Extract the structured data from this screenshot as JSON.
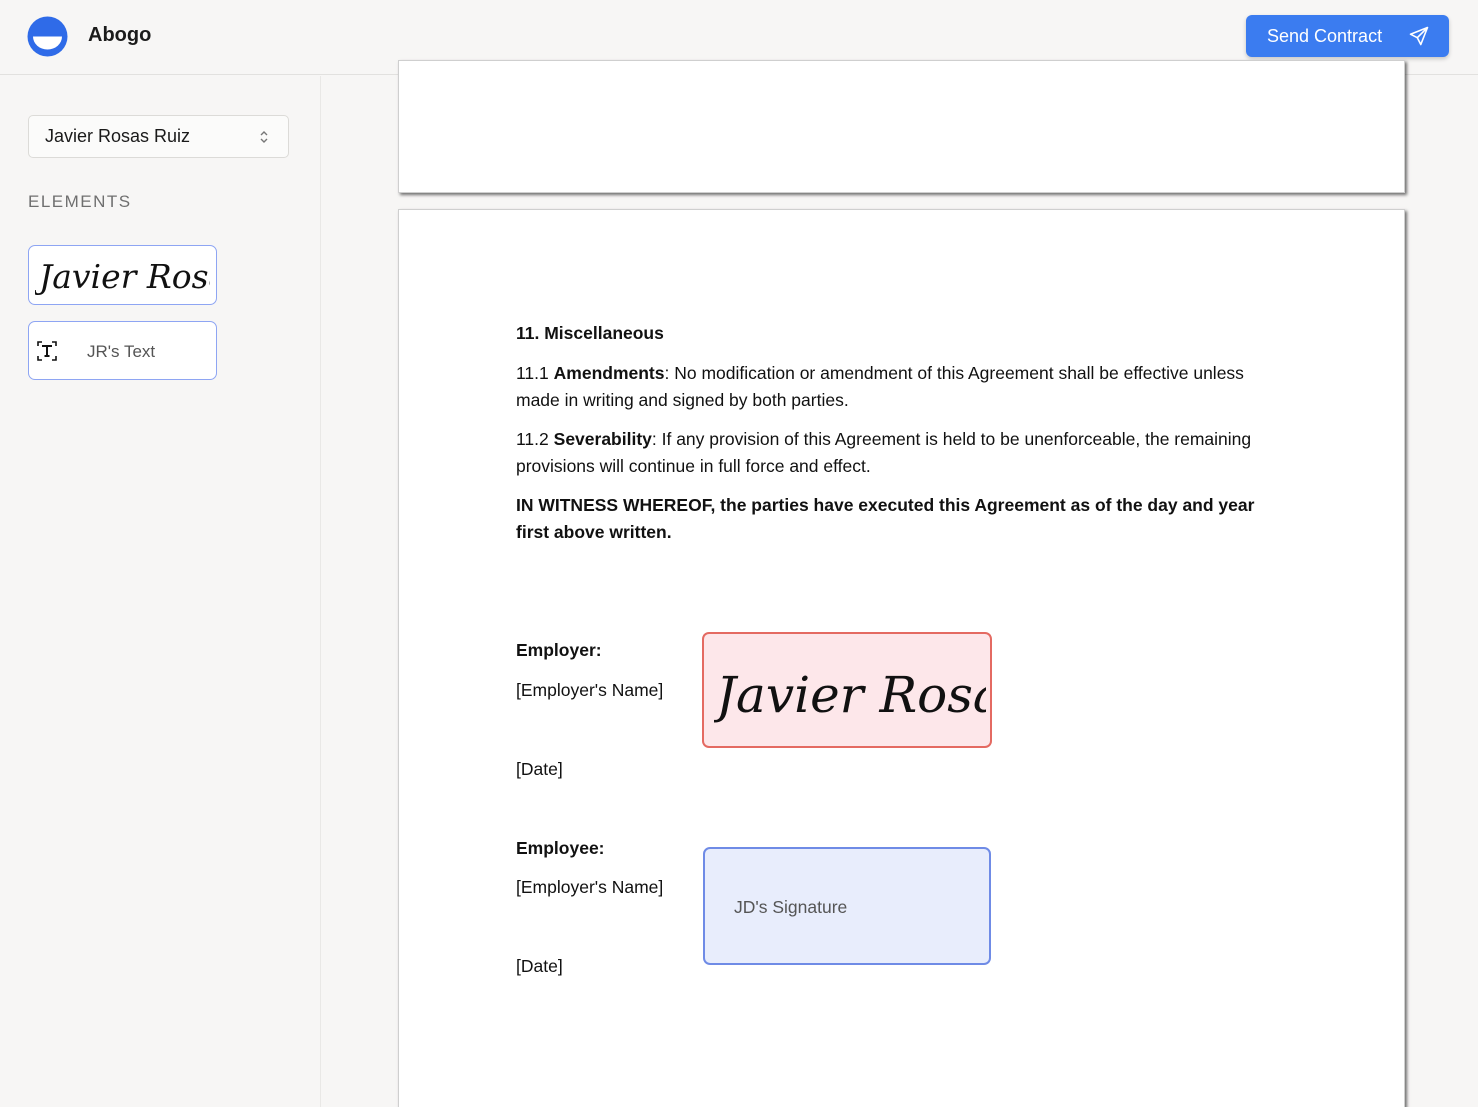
{
  "app": {
    "name": "Abogo"
  },
  "header": {
    "send_label": "Send Contract",
    "accent": "#3b7cf0"
  },
  "sidebar": {
    "signer_select": {
      "value": "Javier Rosas Ruiz"
    },
    "section_label": "ELEMENTS",
    "elements": [
      {
        "type": "signature",
        "preview": "Javier Rosas"
      },
      {
        "type": "text",
        "label": "JR's Text",
        "icon": "text-icon"
      }
    ]
  },
  "document": {
    "heading": "11. Miscellaneous",
    "clauses": [
      {
        "number": "11.1",
        "title": "Amendments",
        "body": ": No modification or amendment of this Agreement shall be effective unless made in writing and signed by both parties."
      },
      {
        "number": "11.2",
        "title": "Severability",
        "body": ": If any provision of this Agreement is held to be unenforceable, the remaining provisions will continue in full force and effect."
      }
    ],
    "witness": "IN WITNESS WHEREOF, the parties have executed this Agreement as of the day and year first above written.",
    "employer": {
      "label": "Employer:",
      "name": "[Employer's Name]",
      "date": "[Date]",
      "signature": "Javier Rosas",
      "signature_color": "#e46a62"
    },
    "employee": {
      "label": "Employee:",
      "name": "[Employer's Name]",
      "date": "[Date]",
      "placeholder": "JD's Signature",
      "placeholder_color": "#6f8be6"
    }
  }
}
